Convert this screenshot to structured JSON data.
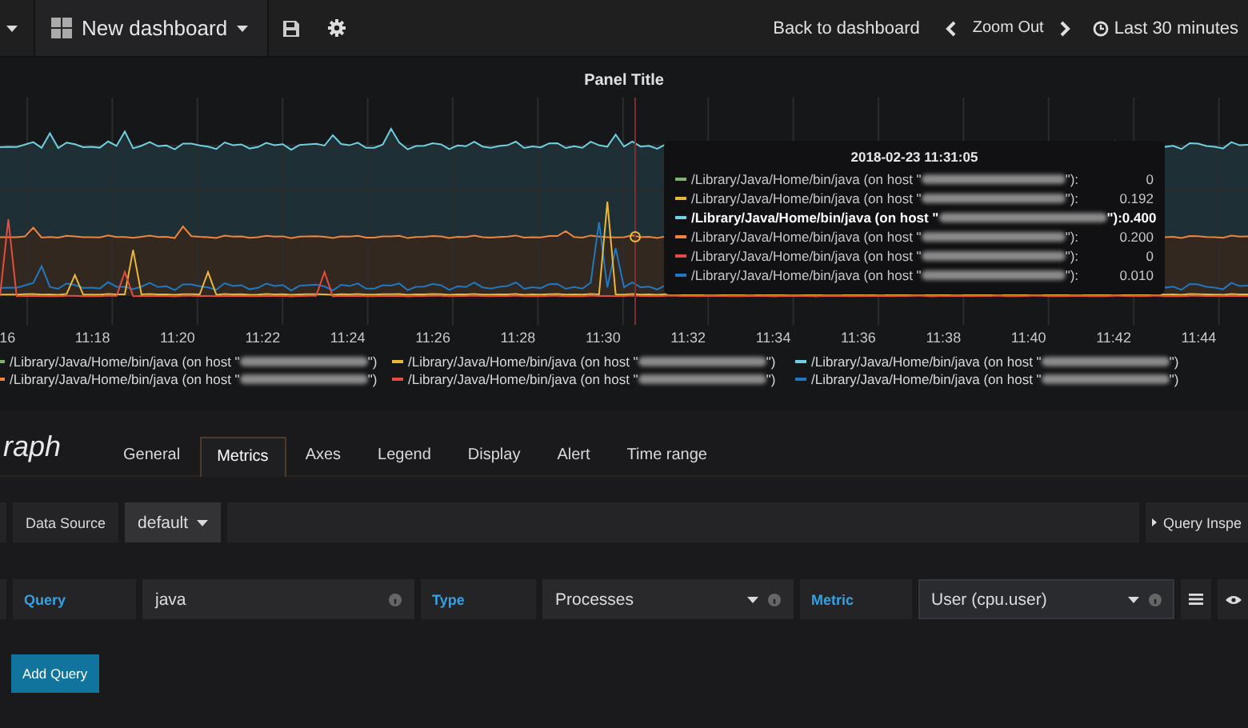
{
  "topbar": {
    "title": "New dashboard",
    "back": "Back to dashboard",
    "zoom": "Zoom Out",
    "range": "Last 30 minutes"
  },
  "panel": {
    "title": "Panel Title",
    "x_ticks": [
      "16",
      "11:18",
      "11:20",
      "11:22",
      "11:24",
      "11:26",
      "11:28",
      "11:30",
      "11:32",
      "11:34",
      "11:36",
      "11:38",
      "11:40",
      "11:42",
      "11:44"
    ],
    "legend": [
      {
        "color": "#7eb26d",
        "label": "/Library/Java/Home/bin/java (on host \"",
        "suffix": "\")"
      },
      {
        "color": "#eab839",
        "label": "/Library/Java/Home/bin/java (on host \"",
        "suffix": "\")"
      },
      {
        "color": "#6ed0e0",
        "label": "/Library/Java/Home/bin/java (on host \"",
        "suffix": "\")"
      },
      {
        "color": "#ef843c",
        "label": "/Library/Java/Home/bin/java (on host \"",
        "suffix": "\")"
      },
      {
        "color": "#e24d42",
        "label": "/Library/Java/Home/bin/java (on host \"",
        "suffix": "\")"
      },
      {
        "color": "#1f78c1",
        "label": "/Library/Java/Home/bin/java (on host \"",
        "suffix": "\")"
      }
    ],
    "tooltip": {
      "time": "2018-02-23 11:31:05",
      "rows": [
        {
          "color": "#7eb26d",
          "label": "/Library/Java/Home/bin/java (on host \"",
          "suffix": "\"):",
          "value": "0",
          "highlighted": false
        },
        {
          "color": "#eab839",
          "label": "/Library/Java/Home/bin/java (on host \"",
          "suffix": "\"):",
          "value": "0.192",
          "highlighted": false
        },
        {
          "color": "#6ed0e0",
          "label": "/Library/Java/Home/bin/java (on host \"",
          "suffix": "\"):",
          "value": "0.400",
          "highlighted": true
        },
        {
          "color": "#ef843c",
          "label": "/Library/Java/Home/bin/java (on host \"",
          "suffix": "\"):",
          "value": "0.200",
          "highlighted": false
        },
        {
          "color": "#e24d42",
          "label": "/Library/Java/Home/bin/java (on host \"",
          "suffix": "\"):",
          "value": "0",
          "highlighted": false
        },
        {
          "color": "#1f78c1",
          "label": "/Library/Java/Home/bin/java (on host \"",
          "suffix": "\"):",
          "value": "0.010",
          "highlighted": false
        }
      ]
    }
  },
  "editor": {
    "panel_type": "raph",
    "tabs": [
      {
        "label": "General",
        "selected": false
      },
      {
        "label": "Metrics",
        "selected": true
      },
      {
        "label": "Axes",
        "selected": false
      },
      {
        "label": "Legend",
        "selected": false
      },
      {
        "label": "Display",
        "selected": false
      },
      {
        "label": "Alert",
        "selected": false
      },
      {
        "label": "Time range",
        "selected": false
      }
    ],
    "datasource": {
      "label": "Data Source",
      "value": "default"
    },
    "inspector": "Query Inspe",
    "query_row": [
      {
        "kind": "label",
        "text": "Query"
      },
      {
        "kind": "input",
        "text": "java"
      },
      {
        "kind": "label",
        "text": "Type"
      },
      {
        "kind": "select",
        "text": "Processes"
      },
      {
        "kind": "label",
        "text": "Metric"
      },
      {
        "kind": "select",
        "text": "User (cpu.user)",
        "focused": true
      }
    ],
    "add_button": "Add Query"
  }
}
